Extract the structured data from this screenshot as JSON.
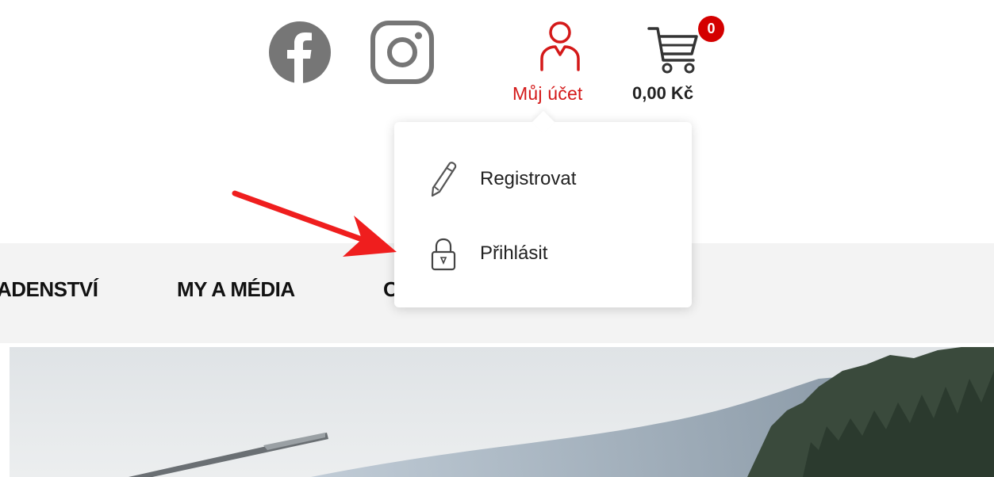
{
  "social": {
    "facebook_icon": "facebook-icon",
    "instagram_icon": "instagram-icon"
  },
  "account": {
    "icon": "user-icon",
    "label": "Můj účet"
  },
  "cart": {
    "icon": "cart-icon",
    "count": "0",
    "total": "0,00 Kč"
  },
  "nav": {
    "items": [
      {
        "label": "ADENSTVÍ"
      },
      {
        "label": "MY A MÉDIA"
      },
      {
        "label": "O"
      }
    ]
  },
  "account_menu": {
    "items": [
      {
        "icon": "pencil-icon",
        "label": "Registrovat"
      },
      {
        "icon": "lock-icon",
        "label": "Přihlásit"
      }
    ]
  },
  "colors": {
    "accent": "#d41919",
    "badge": "#d40000",
    "annotation_arrow": "#ef1e1e",
    "nav_background": "#f3f3f3",
    "social_icon": "#767676"
  }
}
